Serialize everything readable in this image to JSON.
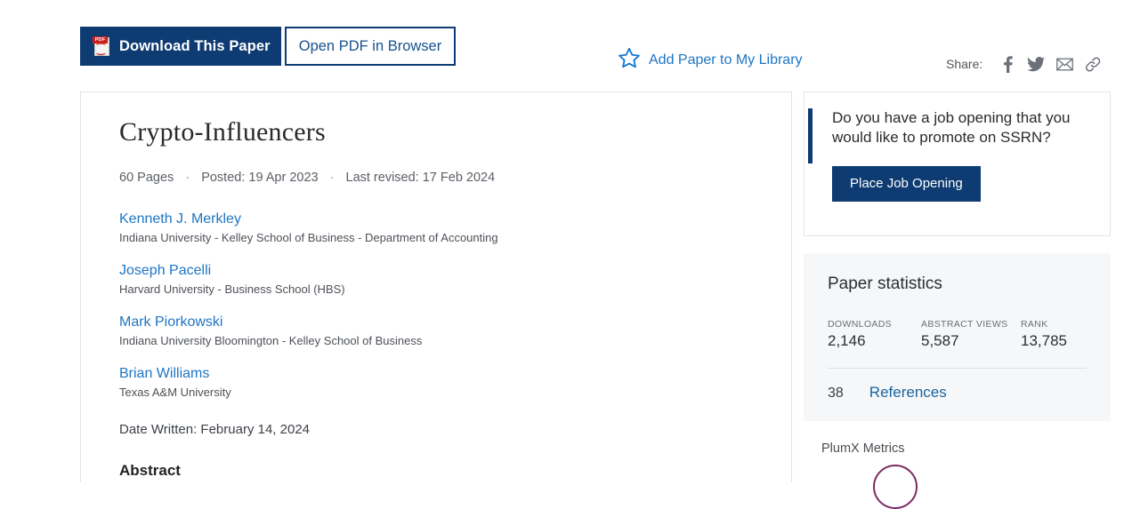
{
  "toolbar": {
    "download_label": "Download This Paper",
    "pdf_badge": "PDF",
    "pdf_glyph": "Å",
    "open_pdf_label": "Open PDF in Browser",
    "add_library_label": "Add Paper to My Library",
    "star_icon": "star-outline-icon",
    "share_label": "Share:",
    "share_icons": [
      {
        "name": "facebook-icon",
        "glyph": "f"
      },
      {
        "name": "twitter-icon",
        "glyph": "🐦"
      },
      {
        "name": "email-icon",
        "glyph": "✉"
      },
      {
        "name": "link-icon",
        "glyph": "🔗"
      }
    ]
  },
  "paper": {
    "title": "Crypto-Influencers",
    "pages": "60 Pages",
    "posted": "Posted: 19 Apr 2023",
    "last_revised": "Last revised: 17 Feb 2024",
    "separator": "·",
    "authors": [
      {
        "name": "Kenneth J. Merkley",
        "affiliation": "Indiana University - Kelley School of Business - Department of Accounting"
      },
      {
        "name": "Joseph Pacelli",
        "affiliation": "Harvard University - Business School (HBS)"
      },
      {
        "name": "Mark Piorkowski",
        "affiliation": "Indiana University Bloomington - Kelley School of Business"
      },
      {
        "name": "Brian Williams",
        "affiliation": "Texas A&M University"
      }
    ],
    "date_written": "Date Written: February 14, 2024",
    "abstract_heading": "Abstract"
  },
  "job_card": {
    "text": "Do you have a job opening that you would like to promote on SSRN?",
    "button_label": "Place Job Opening"
  },
  "stats": {
    "title": "Paper statistics",
    "items": [
      {
        "key": "DOWNLOADS",
        "value": "2,146"
      },
      {
        "key": "ABSTRACT VIEWS",
        "value": "5,587"
      },
      {
        "key": "RANK",
        "value": "13,785"
      }
    ],
    "references_count": "38",
    "references_label": "References"
  },
  "plumx": {
    "title": "PlumX Metrics"
  },
  "colors": {
    "brand_navy": "#0d3b72",
    "link_blue": "#1e75c4",
    "star_blue": "#1277d4",
    "stats_bg": "#f6f7f9",
    "border_gray": "#dfe3e8",
    "plumx_purple": "#7d2b63",
    "pdf_red": "#cc1f1f"
  }
}
